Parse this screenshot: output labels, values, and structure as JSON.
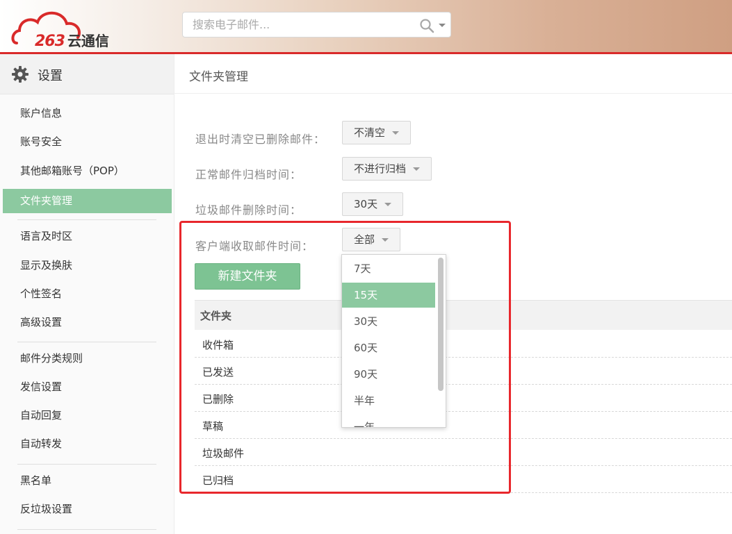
{
  "header": {
    "logo_text": "263",
    "logo_cn": "云通信",
    "search_placeholder": "搜索电子邮件..."
  },
  "sidebar": {
    "title": "设置",
    "items": [
      {
        "label": "账户信息",
        "active": false
      },
      {
        "label": "账号安全",
        "active": false
      },
      {
        "label": "其他邮箱账号（POP）",
        "active": false
      },
      {
        "label": "文件夹管理",
        "active": true
      },
      {
        "label": "语言及时区",
        "active": false
      },
      {
        "label": "显示及换肤",
        "active": false
      },
      {
        "label": "个性签名",
        "active": false
      },
      {
        "label": "高级设置",
        "active": false
      },
      {
        "label": "邮件分类规则",
        "active": false
      },
      {
        "label": "发信设置",
        "active": false
      },
      {
        "label": "自动回复",
        "active": false
      },
      {
        "label": "自动转发",
        "active": false
      },
      {
        "label": "黑名单",
        "active": false
      },
      {
        "label": "反垃圾设置",
        "active": false
      }
    ]
  },
  "main": {
    "title": "文件夹管理",
    "settings": [
      {
        "label": "退出时清空已删除邮件：",
        "value": "不清空"
      },
      {
        "label": "正常邮件归档时间：",
        "value": "不进行归档"
      },
      {
        "label": "垃圾邮件删除时间：",
        "value": "30天"
      },
      {
        "label": "客户端收取邮件时间：",
        "value": "全部"
      }
    ],
    "new_folder_button": "新建文件夹",
    "table": {
      "header": "文件夹",
      "rows": [
        "收件箱",
        "已发送",
        "已删除",
        "草稿",
        "垃圾邮件",
        "已归档"
      ]
    },
    "dropdown": {
      "options": [
        "7天",
        "15天",
        "30天",
        "60天",
        "90天",
        "半年",
        "一年"
      ],
      "highlighted": "15天"
    }
  },
  "colors": {
    "accent_green": "#8cc9a0",
    "header_border_red": "#d92a2a",
    "highlight_red": "#e8272c"
  }
}
